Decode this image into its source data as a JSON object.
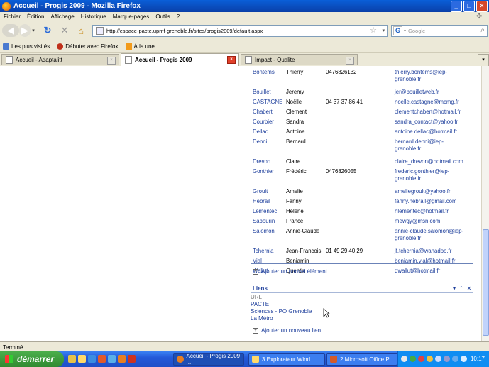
{
  "window": {
    "title": "Accueil - Progis 2009 - Mozilla Firefox",
    "buttons": [
      "_",
      "□",
      "×"
    ]
  },
  "menu": [
    "Fichier",
    "Édition",
    "Affichage",
    "Historique",
    "Marque-pages",
    "Outils",
    "?"
  ],
  "nav": {
    "url": "http://espace-pacte.upmf-grenoble.fr/sites/progis2009/default.aspx",
    "search_placeholder": "Google"
  },
  "bookmarks": [
    "Les plus visités",
    "Débuter avec Firefox",
    "À la une"
  ],
  "tabs": [
    {
      "label": "Accueil - Adaptalitt"
    },
    {
      "label": "Accueil - Progis 2009"
    },
    {
      "label": "Impact - Qualite"
    }
  ],
  "contacts": [
    {
      "last": "Bontems",
      "first": "Thierry",
      "phone": "0476826132",
      "email": "thierry.bontems@iep-",
      "email2": "grenoble.fr"
    },
    {
      "last": "Bouillet",
      "first": "Jeremy",
      "phone": "",
      "email": "jer@bouilletweb.fr",
      "email2": ""
    },
    {
      "last": "CASTAGNE",
      "first": "Noëlle",
      "phone": "04 37 37 86 41",
      "email": "noelle.castagne@mcmg.fr",
      "email2": ""
    },
    {
      "last": "Chabert",
      "first": "Clement",
      "phone": "",
      "email": "clementchabert@hotmail.fr",
      "email2": ""
    },
    {
      "last": "Courbier",
      "first": "Sandra",
      "phone": "",
      "email": "sandra_contact@yahoo.fr",
      "email2": ""
    },
    {
      "last": "Dellac",
      "first": "Antoine",
      "phone": "",
      "email": "antoine.dellac@hotmail.fr",
      "email2": ""
    },
    {
      "last": "Denni",
      "first": "Bernard",
      "phone": "",
      "email": "bernard.denni@iep-",
      "email2": "grenoble.fr"
    },
    {
      "last": "Drevon",
      "first": "Claire",
      "phone": "",
      "email": "claire_drevon@hotmail.com",
      "email2": ""
    },
    {
      "last": "Gonthier",
      "first": "Frédéric",
      "phone": "0476826055",
      "email": "frederic.gonthier@iep-",
      "email2": "grenoble.fr"
    },
    {
      "last": "Groult",
      "first": "Amelie",
      "phone": "",
      "email": "ameliegroult@yahoo.fr",
      "email2": ""
    },
    {
      "last": "Hebrail",
      "first": "Fanny",
      "phone": "",
      "email": "fanny.hebrail@gmail.com",
      "email2": ""
    },
    {
      "last": "Lementec",
      "first": "Helene",
      "phone": "",
      "email": "hlementec@hotmail.fr",
      "email2": ""
    },
    {
      "last": "Sabourin",
      "first": "France",
      "phone": "",
      "email": "mewgy@msn.com",
      "email2": ""
    },
    {
      "last": "Salomon",
      "first": "Annie-Claude",
      "phone": "",
      "email": "annie-claude.salomon@iep-",
      "email2": "grenoble.fr"
    },
    {
      "last": "Tchernia",
      "first": "Jean-Francois",
      "phone": "01 49 29 40 29",
      "email": "jf.tchernia@wanadoo.fr",
      "email2": ""
    },
    {
      "last": "Vial",
      "first": "Benjamin",
      "phone": "",
      "email": "benjamin.vial@hotmail.fr",
      "email2": ""
    },
    {
      "last": "Wallut",
      "first": "Quentin",
      "phone": "",
      "email": "qwallut@hotmail.fr",
      "email2": ""
    }
  ],
  "add_item": "Ajouter un nouvel élément",
  "links_section": {
    "title": "Liens",
    "header": "URL",
    "items": [
      "PACTE",
      "Sciences - PO Grenoble",
      "La Métro"
    ],
    "add": "Ajouter un nouveau lien"
  },
  "status": "Terminé",
  "taskbar": {
    "start": "démarrer",
    "buttons": [
      "Accueil - Progis 2009 ...",
      "3 Explorateur Wind...",
      "2 Microsoft Office P..."
    ],
    "clock": "10:17"
  }
}
